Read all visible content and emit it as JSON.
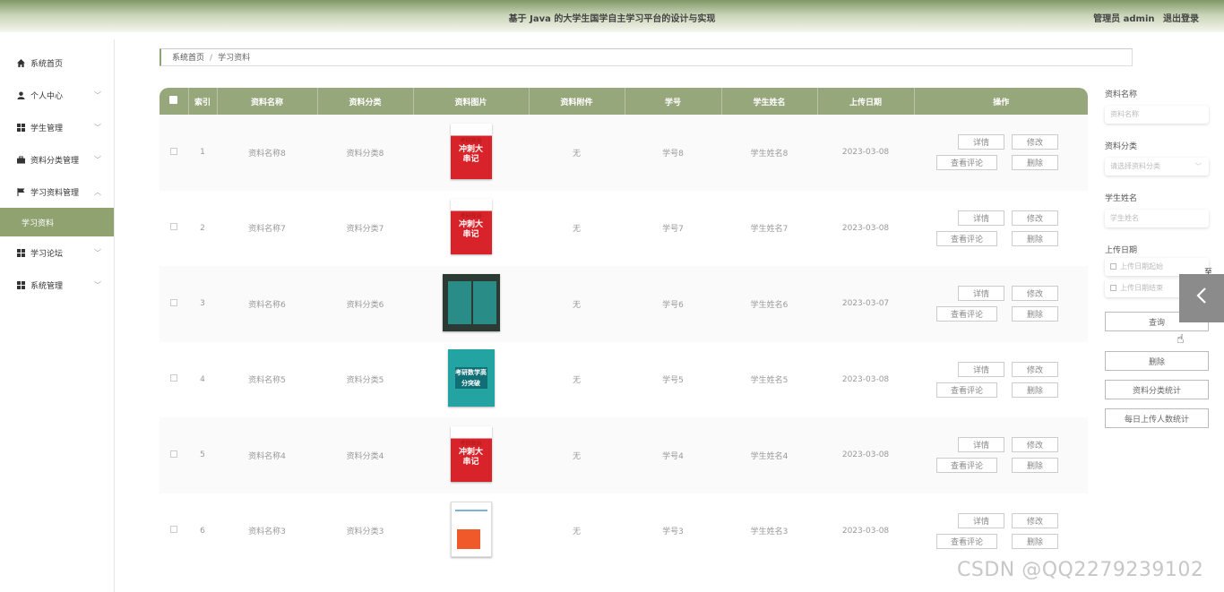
{
  "header": {
    "title": "基于 Java 的大学生国学自主学习平台的设计与实现",
    "user": "管理员 admin",
    "logout": "退出登录"
  },
  "sidebar": {
    "items": [
      {
        "label": "系统首页",
        "icon": "home-icon"
      },
      {
        "label": "个人中心",
        "icon": "user-icon"
      },
      {
        "label": "学生管理",
        "icon": "grid-icon"
      },
      {
        "label": "资料分类管理",
        "icon": "briefcase-icon"
      },
      {
        "label": "学习资料管理",
        "icon": "flag-icon"
      },
      {
        "label": "学习资料",
        "icon": ""
      },
      {
        "label": "学习论坛",
        "icon": "grid-icon"
      },
      {
        "label": "系统管理",
        "icon": "grid-icon"
      }
    ]
  },
  "breadcrumb": {
    "home": "系统首页",
    "separator": "/",
    "current": "学习资料"
  },
  "table": {
    "columns": [
      "索引",
      "资料名称",
      "资料分类",
      "资料图片",
      "资料附件",
      "学号",
      "学生姓名",
      "上传日期",
      "操作"
    ],
    "rows": [
      {
        "index": "1",
        "name": "资料名称8",
        "category": "资料分类8",
        "attachment": "无",
        "student_no": "学号8",
        "student_name": "学生姓名8",
        "date": "2023-03-08",
        "cover": "red"
      },
      {
        "index": "2",
        "name": "资料名称7",
        "category": "资料分类7",
        "attachment": "无",
        "student_no": "学号7",
        "student_name": "学生姓名7",
        "date": "2023-03-08",
        "cover": "red"
      },
      {
        "index": "3",
        "name": "资料名称6",
        "category": "资料分类6",
        "attachment": "无",
        "student_no": "学号6",
        "student_name": "学生姓名6",
        "date": "2023-03-07",
        "cover": "dark"
      },
      {
        "index": "4",
        "name": "资料名称5",
        "category": "资料分类5",
        "attachment": "无",
        "student_no": "学号5",
        "student_name": "学生姓名5",
        "date": "2023-03-08",
        "cover": "teal"
      },
      {
        "index": "5",
        "name": "资料名称4",
        "category": "资料分类4",
        "attachment": "无",
        "student_no": "学号4",
        "student_name": "学生姓名4",
        "date": "2023-03-08",
        "cover": "red"
      },
      {
        "index": "6",
        "name": "资料名称3",
        "category": "资料分类3",
        "attachment": "无",
        "student_no": "学号3",
        "student_name": "学生姓名3",
        "date": "2023-03-08",
        "cover": "orange"
      }
    ],
    "actions": {
      "detail": "详情",
      "edit": "修改",
      "comments": "查看评论",
      "delete": "删除"
    },
    "cover_text": {
      "red_top": "考研政治",
      "red_title": "冲刺大串记",
      "teal_title": "考研数学高分突破"
    }
  },
  "search": {
    "name_label": "资料名称",
    "name_placeholder": "资料名称",
    "category_label": "资料分类",
    "category_placeholder": "请选择资料分类",
    "student_label": "学生姓名",
    "student_placeholder": "学生姓名",
    "date_label": "上传日期",
    "date_start_placeholder": "上传日期起始",
    "date_end_placeholder": "上传日期结束",
    "to": "至",
    "query": "查询",
    "delete": "删除",
    "category_stats": "资料分类统计",
    "daily_stats": "每日上传人数统计"
  },
  "watermark": "CSDN @QQ2279239102",
  "colors": {
    "accent": "#8fa26f",
    "header_start": "#7f9766"
  }
}
